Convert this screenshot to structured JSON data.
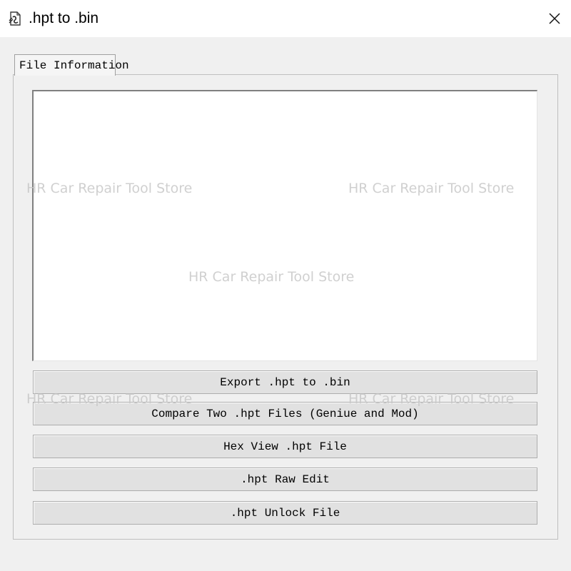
{
  "window": {
    "title": ".hpt to .bin",
    "icon": "app-file-icon",
    "close_icon": "close-icon"
  },
  "tabs": [
    {
      "label": "File Information",
      "active": true
    }
  ],
  "info_box": {
    "content": ""
  },
  "buttons": [
    {
      "label": "Export .hpt to .bin"
    },
    {
      "label": "Compare Two .hpt Files (Geniue and Mod)"
    },
    {
      "label": "Hex View .hpt File"
    },
    {
      "label": ".hpt Raw Edit"
    },
    {
      "label": ".hpt Unlock File"
    }
  ],
  "watermark": {
    "text": "HR Car Repair Tool Store"
  },
  "colors": {
    "window_bg": "#f0f0f0",
    "titlebar_bg": "#ffffff",
    "button_bg": "#e1e1e1",
    "button_border": "#adadad",
    "watermark": "#c8c8c8"
  }
}
